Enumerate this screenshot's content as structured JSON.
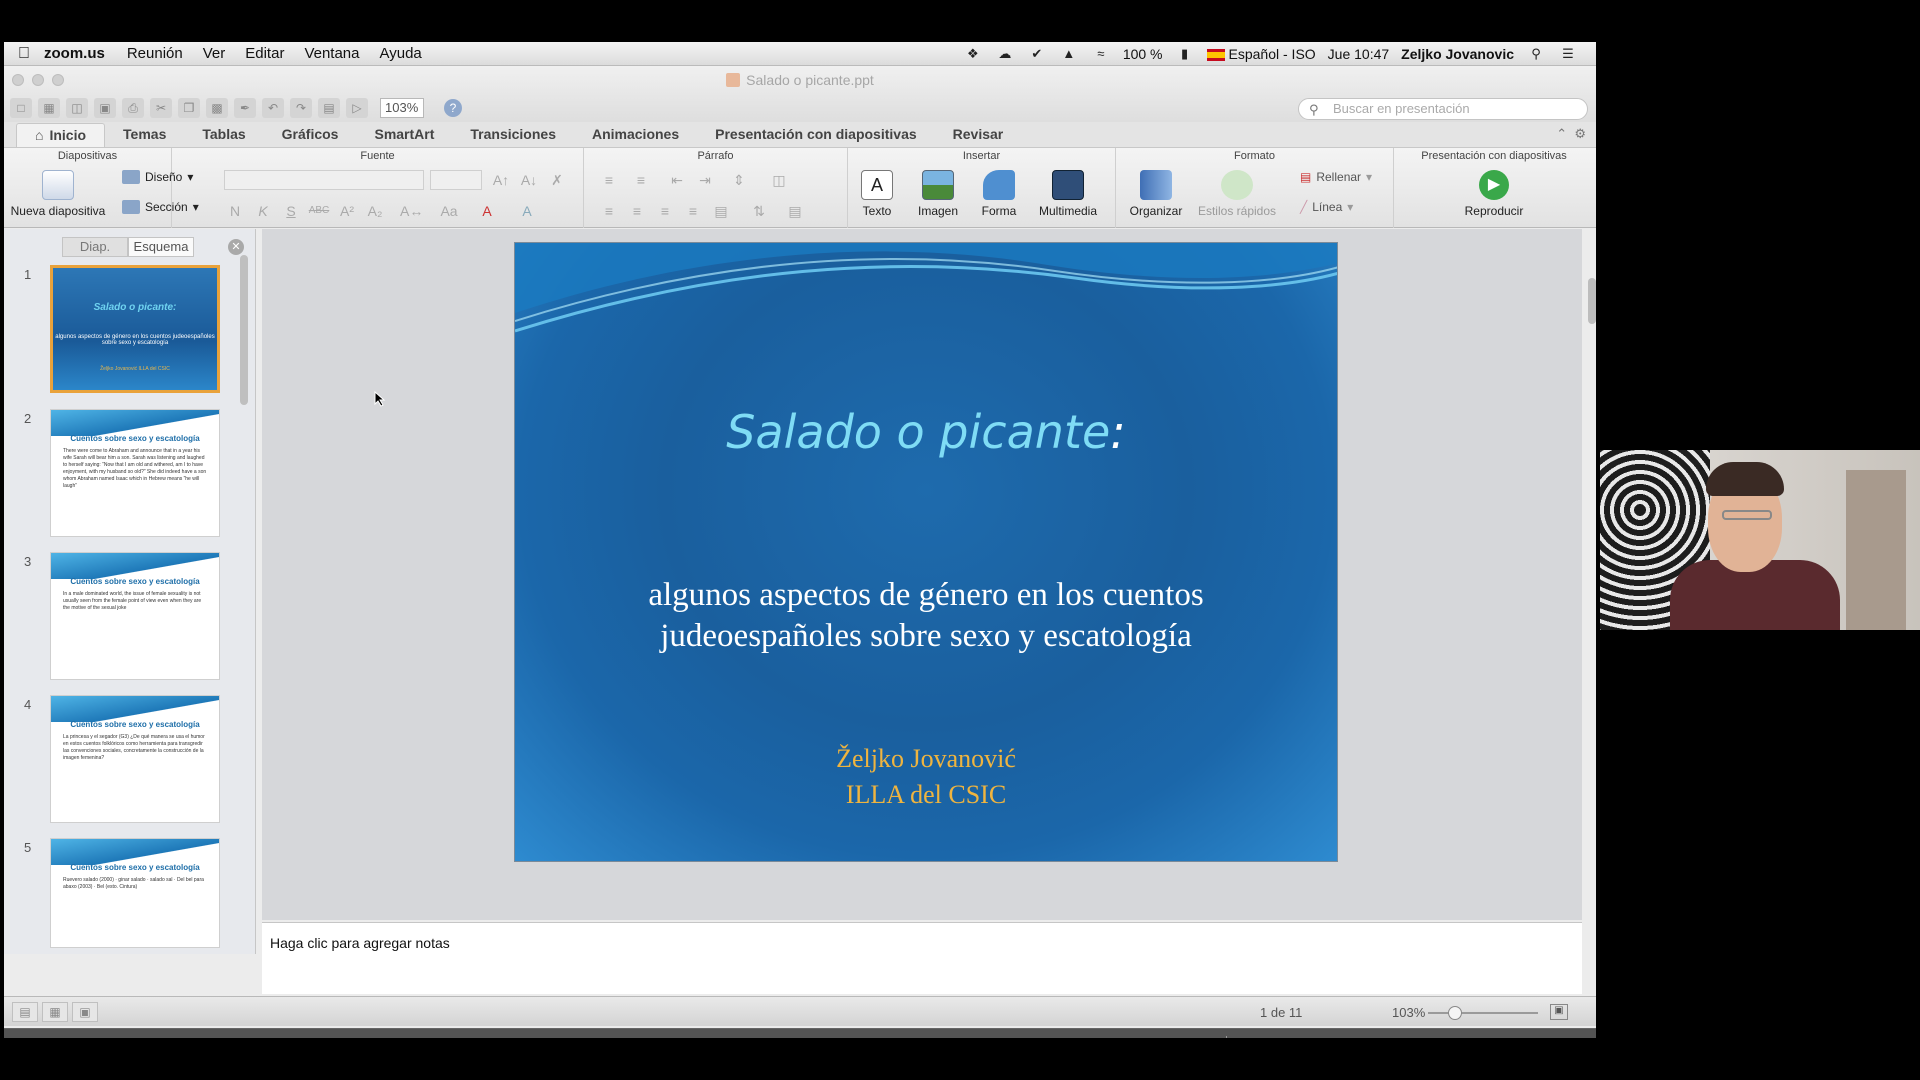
{
  "menubar": {
    "app": "zoom.us",
    "menus": [
      "Reunión",
      "Ver",
      "Editar",
      "Ventana",
      "Ayuda"
    ],
    "battery": "100 %",
    "language": "Español - ISO",
    "clock": "Jue 10:47",
    "user": "Zeljko Jovanovic"
  },
  "window": {
    "title": "Salado o picante.ppt",
    "zoom": "103%",
    "search_placeholder": "Buscar en presentación"
  },
  "ribbon_tabs": [
    "Inicio",
    "Temas",
    "Tablas",
    "Gráficos",
    "SmartArt",
    "Transiciones",
    "Animaciones",
    "Presentación con diapositivas",
    "Revisar"
  ],
  "ribbon": {
    "groups": {
      "diapositivas": "Diapositivas",
      "fuente": "Fuente",
      "parrafo": "Párrafo",
      "insertar": "Insertar",
      "formato": "Formato",
      "presentacion": "Presentación con diapositivas"
    },
    "nueva_diapositiva": "Nueva diapositiva",
    "diseno": "Diseño",
    "seccion": "Sección",
    "texto": "Texto",
    "imagen": "Imagen",
    "forma": "Forma",
    "multimedia": "Multimedia",
    "organizar": "Organizar",
    "estilos_rapidos": "Estilos rápidos",
    "rellenar": "Rellenar",
    "linea": "Línea",
    "reproducir": "Reproducir",
    "font_buttons": [
      "N",
      "K",
      "S",
      "ABC",
      "A²",
      "A₂"
    ]
  },
  "left_panel": {
    "tab_diap": "Diap.",
    "tab_esquema": "Esquema",
    "thumbs": [
      {
        "num": "1",
        "title": "Salado o picante:",
        "sub": "algunos aspectos de género en los cuentos judeoespañoles sobre sexo y escatología",
        "author": "Željko Jovanović ILLA del CSIC"
      },
      {
        "num": "2",
        "title": "Cuentos sobre sexo y escatología",
        "text": "There were come to Abraham and announce that in a year his wife Sarah will bear him a son. Sarah was listening and laughed to herself saying: “Now that I am old and withered, am I to have enjoyment, with my husband so old?” She did indeed have a son whom Abraham named Isaac which in Hebrew means “he will laugh”"
      },
      {
        "num": "3",
        "title": "Cuentos sobre sexo y escatología",
        "text": "In a male dominated world, the issue of female sexuality is not usually seen from the female point of view even when they are the motive of the sexual joke"
      },
      {
        "num": "4",
        "title": "Cuentos sobre sexo y escatología",
        "text": "La princesa y el segador (G3) ¿De qué manera se usa el humor en estos cuentos folklóricos como herramienta para transgredir las convenciones sociales, concretamente la construcción de la imagen femenina?"
      },
      {
        "num": "5",
        "title": "Cuentos sobre sexo y escatología",
        "text": "Ruevero salado (2000) · ginar salado · salado sal · Del bel para abaxo (2003) · Bel (esto. Cintura)"
      }
    ]
  },
  "slide": {
    "title_main": "Salado o picante",
    "title_colon": ":",
    "subtitle_line1": "algunos aspectos de género en los cuentos",
    "subtitle_line2": "judeoespañoles sobre sexo y escatología",
    "author": "Željko Jovanović",
    "institution": "ILLA del CSIC"
  },
  "notes": {
    "placeholder": "Haga clic para agregar notas"
  },
  "status": {
    "page": "1 de 11",
    "zoom": "103%"
  },
  "colors": {
    "slide_title": "#7fdcf5",
    "slide_author": "#efb43f",
    "selection": "#e9a23b"
  }
}
